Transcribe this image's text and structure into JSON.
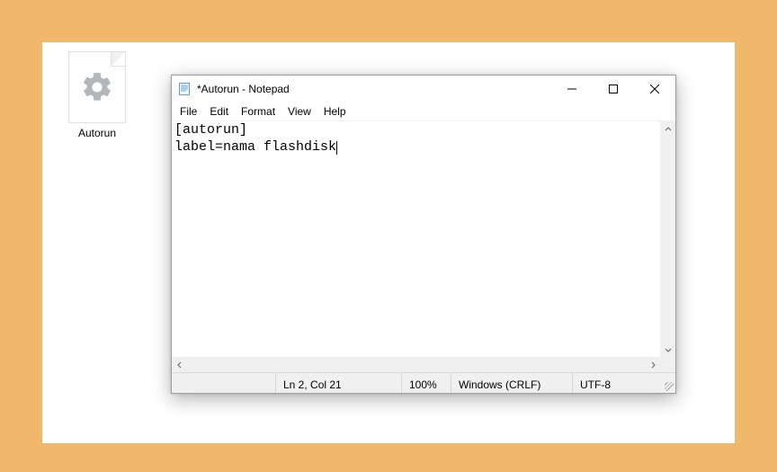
{
  "desktop": {
    "icon_label": "Autorun"
  },
  "window": {
    "title": "*Autorun - Notepad"
  },
  "menu": {
    "file": "File",
    "edit": "Edit",
    "format": "Format",
    "view": "View",
    "help": "Help"
  },
  "editor": {
    "content": "[autorun]\nlabel=nama flashdisk"
  },
  "status": {
    "lncol": "Ln 2, Col 21",
    "zoom": "100%",
    "eol": "Windows (CRLF)",
    "encoding": "UTF-8"
  }
}
